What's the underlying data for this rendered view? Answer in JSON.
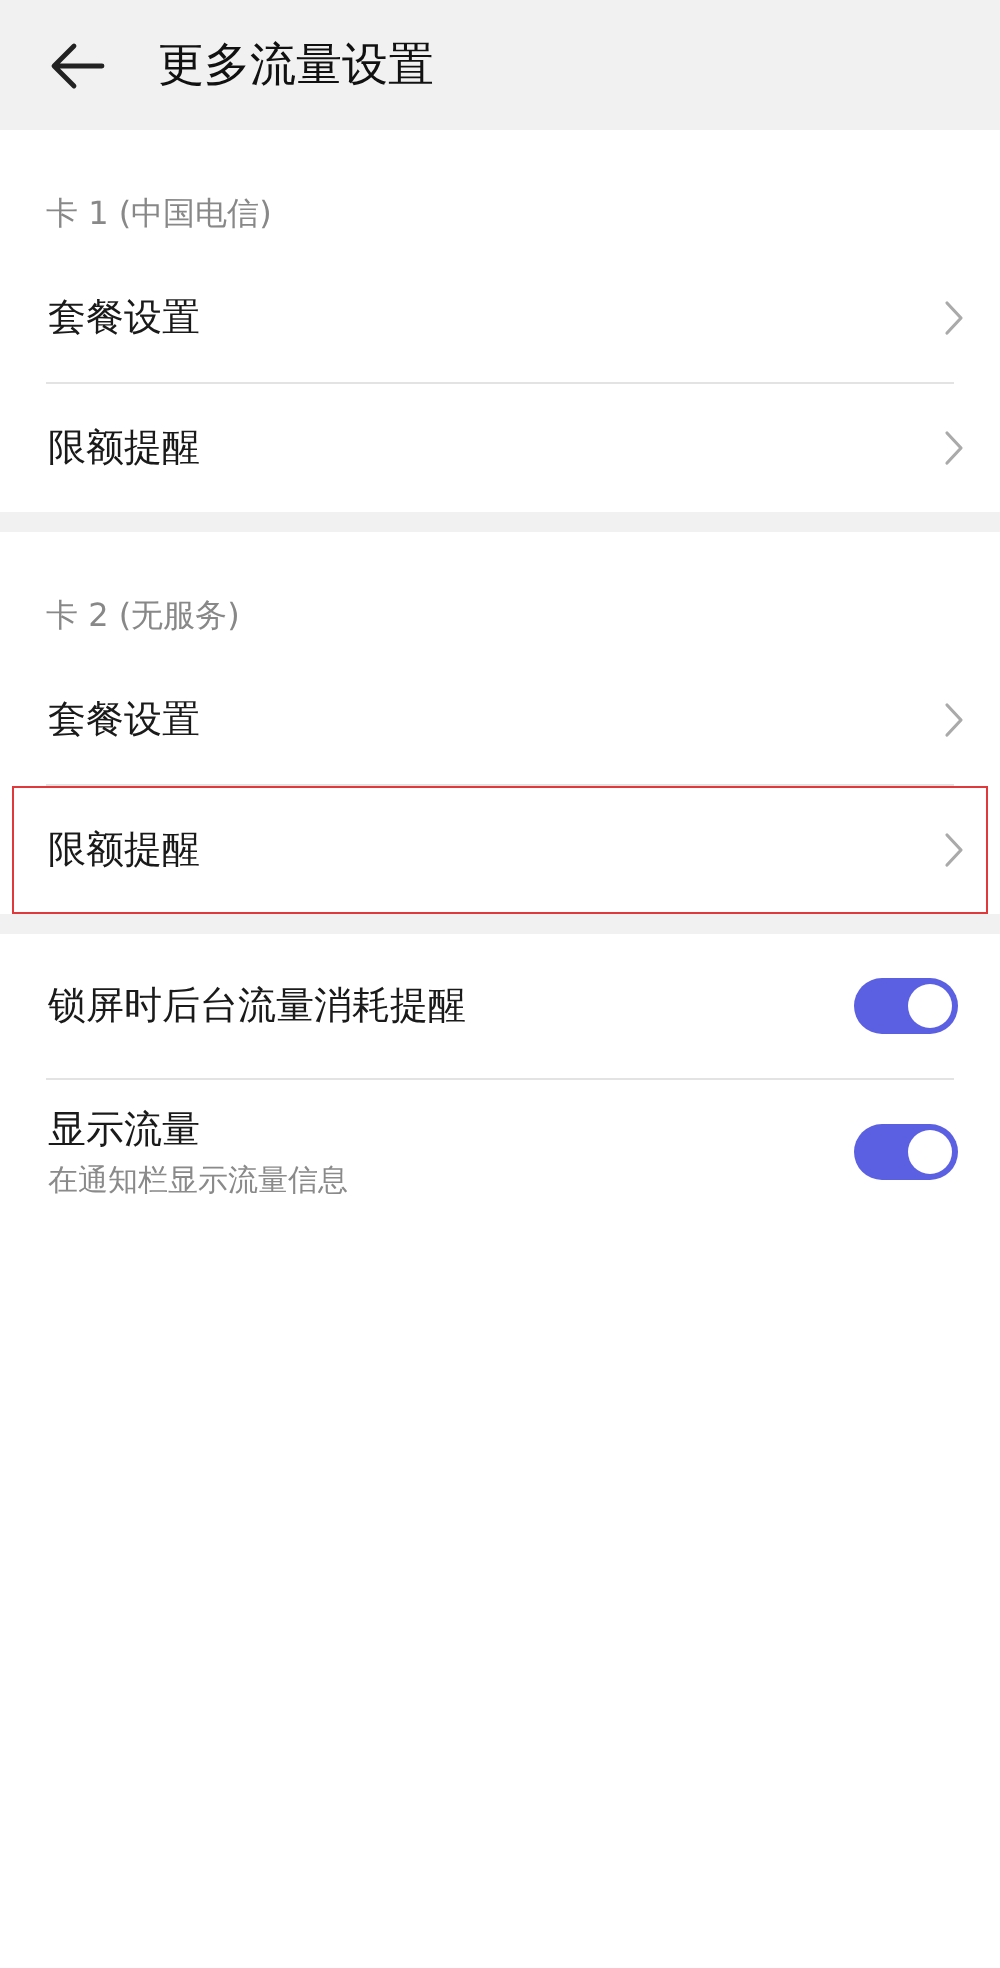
{
  "header": {
    "title": "更多流量设置"
  },
  "sections": [
    {
      "kind": "links",
      "title": "卡 1 (中国电信)",
      "items": [
        {
          "label": "套餐设置",
          "highlighted": false
        },
        {
          "label": "限额提醒",
          "highlighted": false
        }
      ]
    },
    {
      "kind": "links",
      "title": "卡 2 (无服务)",
      "items": [
        {
          "label": "套餐设置",
          "highlighted": false
        },
        {
          "label": "限额提醒",
          "highlighted": true
        }
      ]
    },
    {
      "kind": "toggles",
      "items": [
        {
          "label": "锁屏时后台流量消耗提醒",
          "on": true
        },
        {
          "label": "显示流量",
          "subtitle": "在通知栏显示流量信息",
          "on": true
        }
      ]
    }
  ]
}
